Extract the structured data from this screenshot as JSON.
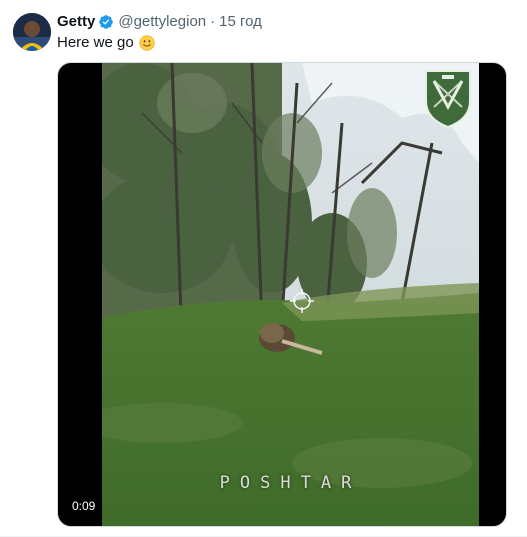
{
  "tweet": {
    "display_name": "Getty",
    "handle": "@gettylegion",
    "separator": "·",
    "timestamp": "15 год",
    "text": "Here we go",
    "emoji_icon": "slightly-smiling-face-icon",
    "verified_icon": "verified-badge-icon",
    "verified_color": "#1d9bf0"
  },
  "media": {
    "duration": "0:09",
    "video_watermark": "POSHTAR",
    "unit_emblem_icon": "military-shield-emblem-icon"
  },
  "colors": {
    "name": "#0f1419",
    "secondary_text": "#536471",
    "media_background": "#000000"
  }
}
